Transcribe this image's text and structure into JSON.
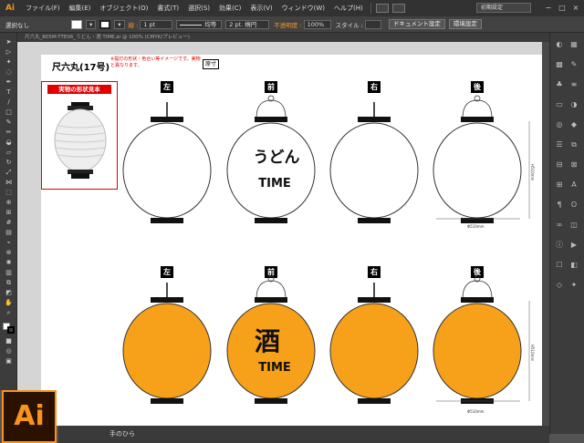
{
  "menubar": {
    "logo": "Ai",
    "items": [
      "ファイル(F)",
      "編集(E)",
      "オブジェクト(O)",
      "書式(T)",
      "選択(S)",
      "効果(C)",
      "表示(V)",
      "ウィンドウ(W)",
      "ヘルプ(H)"
    ],
    "workspace": "初期設定",
    "window_buttons": [
      "−",
      "□",
      "×"
    ]
  },
  "controlbar": {
    "selection_label": "選択なし",
    "stroke_label": "線 :",
    "stroke_value": "1 pt",
    "profile_value": "均等",
    "brush_value": "2 pt. 楕円",
    "opacity_label": "不透明度 :",
    "opacity_value": "100%",
    "style_label": "スタイル :",
    "document_settings": "ドキュメント設定",
    "preferences": "環境設定"
  },
  "tab": {
    "title": "尺六丸_B05M-TTE06_うどん・酒 TIME.ai @ 100% (CMYK/プレビュー)"
  },
  "artboard": {
    "title": "尺六丸(17号)",
    "note": "※提灯の形状・色合い等イメージです。実物と異なります。",
    "badge": "原寸",
    "sample_title": "実物の形状見本",
    "row1_labels": [
      "左",
      "前",
      "右",
      "後"
    ],
    "row2_labels": [
      "左",
      "前",
      "右",
      "後"
    ],
    "front_top_text": "うどん",
    "front_top_sub": "TIME",
    "front_bottom_text": "酒",
    "front_bottom_sub": "TIME",
    "dim_width": "Φ510mm",
    "dim_height": "H510mm"
  },
  "colors": {
    "orange": "#F7A11A",
    "accent": "#F7941D",
    "red": "#E00000"
  },
  "statusbar": {
    "tool": "手のひら"
  },
  "badge": {
    "text": "Ai"
  }
}
